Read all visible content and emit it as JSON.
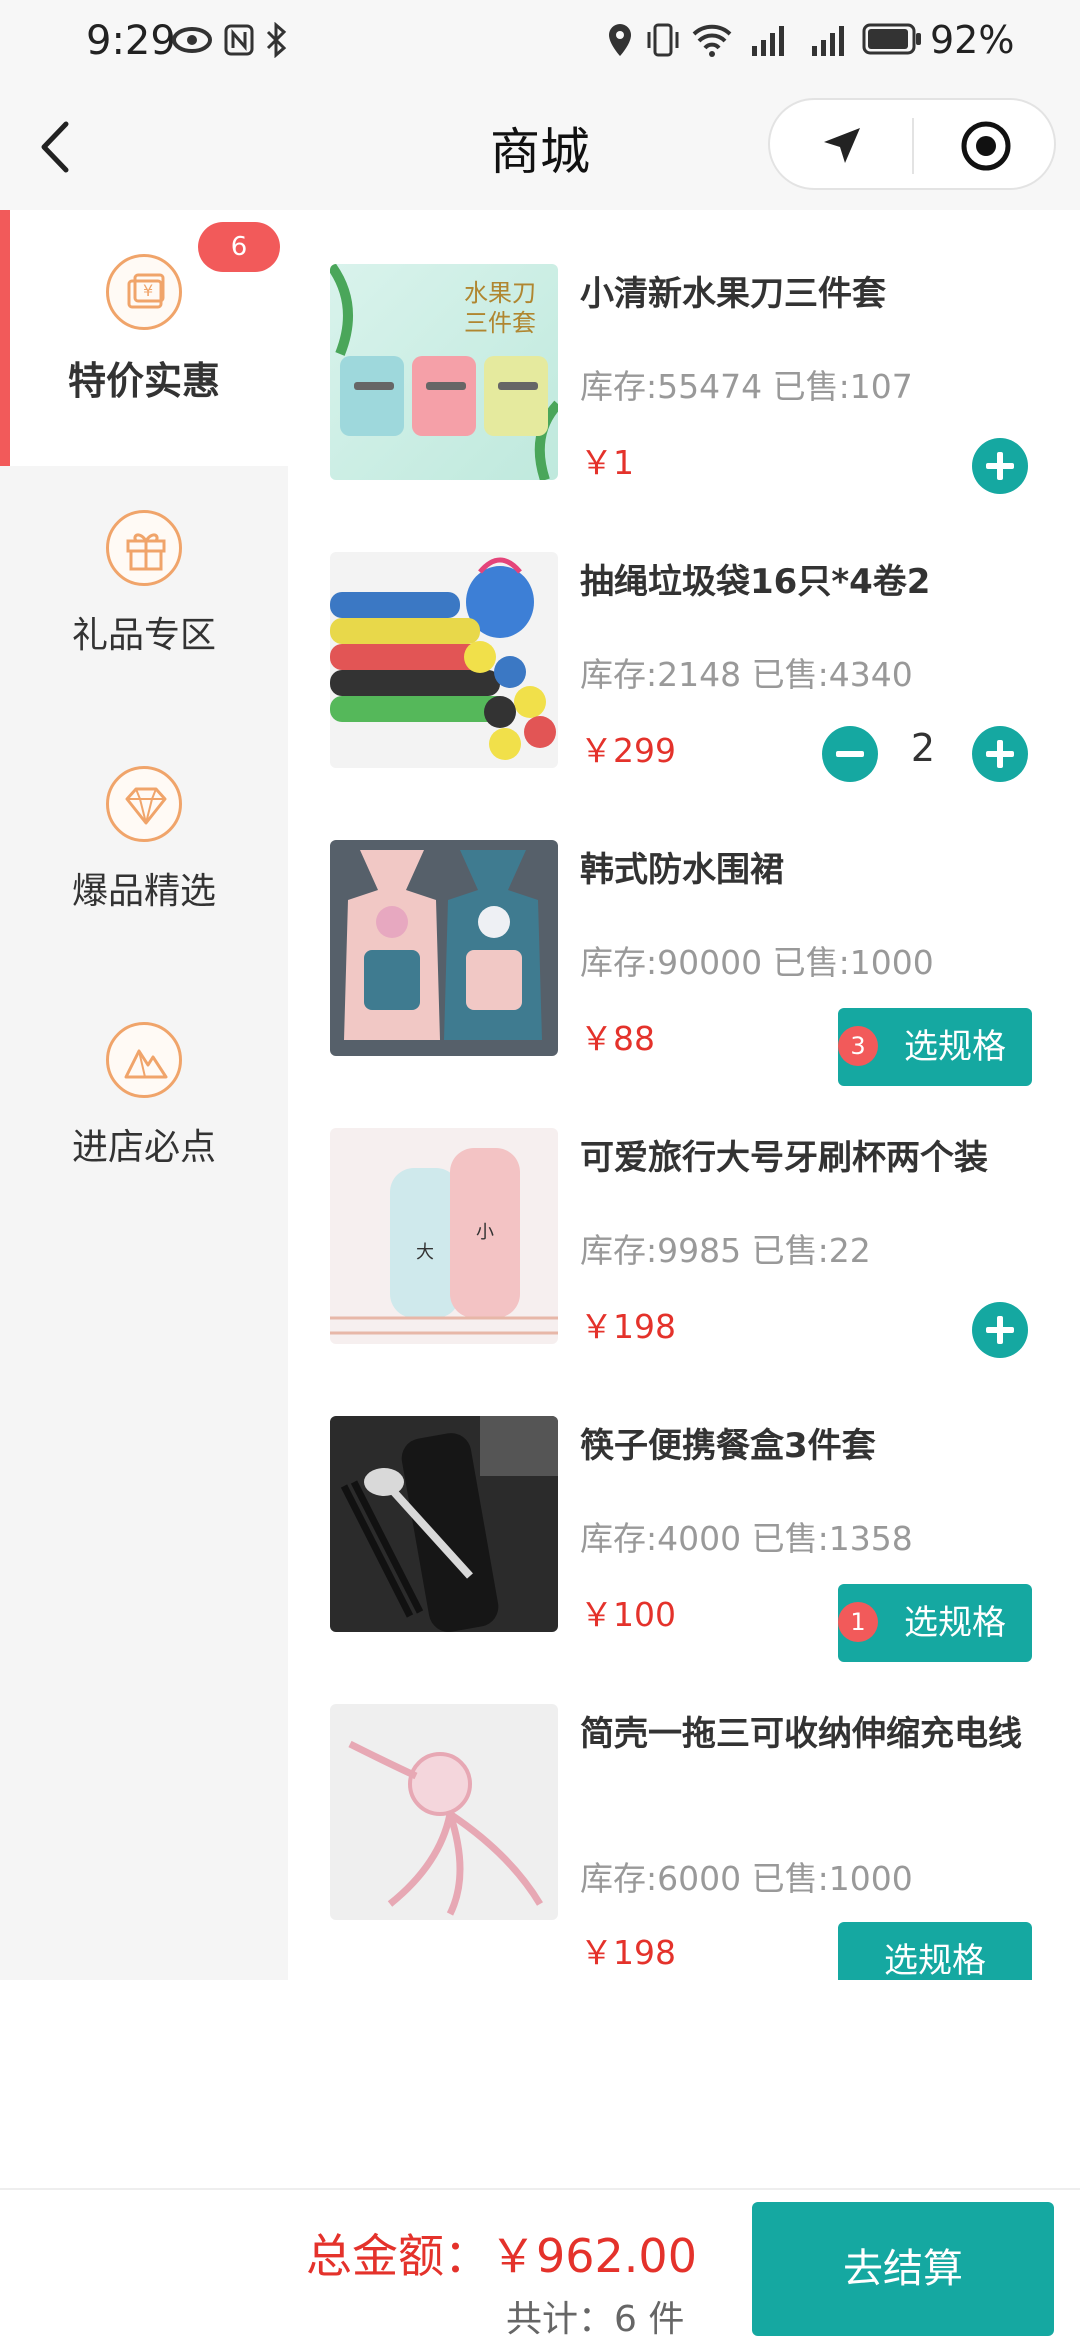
{
  "status_bar": {
    "time": "9:29",
    "battery": "92%"
  },
  "nav": {
    "title": "商城"
  },
  "sidebar": {
    "badge": "6",
    "items": [
      {
        "label": "特价实惠",
        "icon": "coupon-icon"
      },
      {
        "label": "礼品专区",
        "icon": "gift-icon"
      },
      {
        "label": "爆品精选",
        "icon": "diamond-icon"
      },
      {
        "label": "进店必点",
        "icon": "mountain-icon"
      }
    ]
  },
  "products": [
    {
      "name": "小清新水果刀三件套",
      "stock": "库存:55474 已售:107",
      "price": "￥1",
      "image_text": "水果刀\n三件套"
    },
    {
      "name": "抽绳垃圾袋16只*4卷2",
      "stock": "库存:2148 已售:4340",
      "price": "￥299",
      "qty": "2"
    },
    {
      "name": "韩式防水围裙",
      "stock": "库存:90000 已售:1000",
      "price": "￥88",
      "spec_label": "选规格",
      "spec_count": "3"
    },
    {
      "name": "可爱旅行大号牙刷杯两个装",
      "stock": "库存:9985 已售:22",
      "price": "￥198"
    },
    {
      "name": "筷子便携餐盒3件套",
      "stock": "库存:4000 已售:1358",
      "price": "￥100",
      "spec_label": "选规格",
      "spec_count": "1"
    },
    {
      "name": "简壳一拖三可收纳伸缩充电线",
      "stock": "库存:6000 已售:1000",
      "price": "￥198",
      "spec_label": "选规格"
    }
  ],
  "footer": {
    "total": "总金额：￥962.00",
    "count": "共计：6 件",
    "checkout_label": "去结算"
  },
  "colors": {
    "accent": "#15a8a1",
    "price": "#e4322b",
    "badge": "#f25a5a",
    "icon_ring": "#f0a46a"
  }
}
